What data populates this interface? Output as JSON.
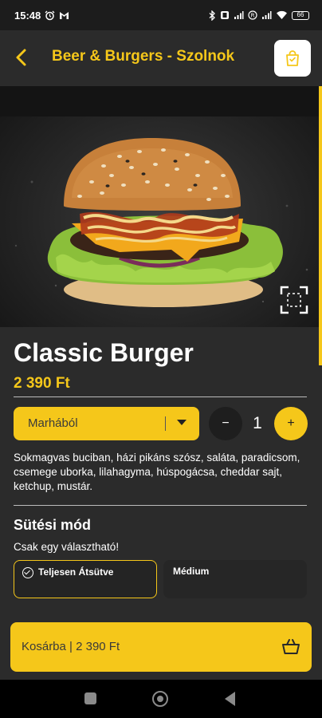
{
  "status_bar": {
    "time": "15:48",
    "left_icons": [
      "alarm-icon",
      "gmail-icon"
    ],
    "right_icons": [
      "bluetooth-icon",
      "vibrate-icon",
      "signal-icon",
      "registered-icon",
      "signal-icon",
      "wifi-icon"
    ],
    "battery": "66"
  },
  "header": {
    "title": "Beer & Burgers - Szolnok",
    "back_icon": "chevron-left-icon",
    "cart_icon": "shopping-bag-icon"
  },
  "product": {
    "name": "Classic Burger",
    "price": "2 390 Ft",
    "image_alt": "Classic Burger image",
    "expand_icon": "fullscreen-icon"
  },
  "options": {
    "meat_select": "Marhából",
    "quantity": "1",
    "minus": "−",
    "plus": "+"
  },
  "description": "Sokmagvas buciban, házi pikáns szósz, saláta, paradicsom, csemege uborka, lilahagyma, húspogácsa, cheddar sajt, ketchup, mustár.",
  "cooking": {
    "title": "Sütési mód",
    "subtitle": "Csak egy választható!",
    "choices": [
      {
        "label": "Teljesen Átsütve",
        "selected": true
      },
      {
        "label": "Médium",
        "selected": false
      }
    ]
  },
  "cart_bar": {
    "label": "Kosárba | 2 390 Ft",
    "icon": "basket-icon"
  },
  "nav": [
    "recents-icon",
    "home-icon",
    "back-icon"
  ],
  "colors": {
    "accent": "#f5c71a",
    "background": "#2b2b2b",
    "dark": "#1e1e1e"
  }
}
